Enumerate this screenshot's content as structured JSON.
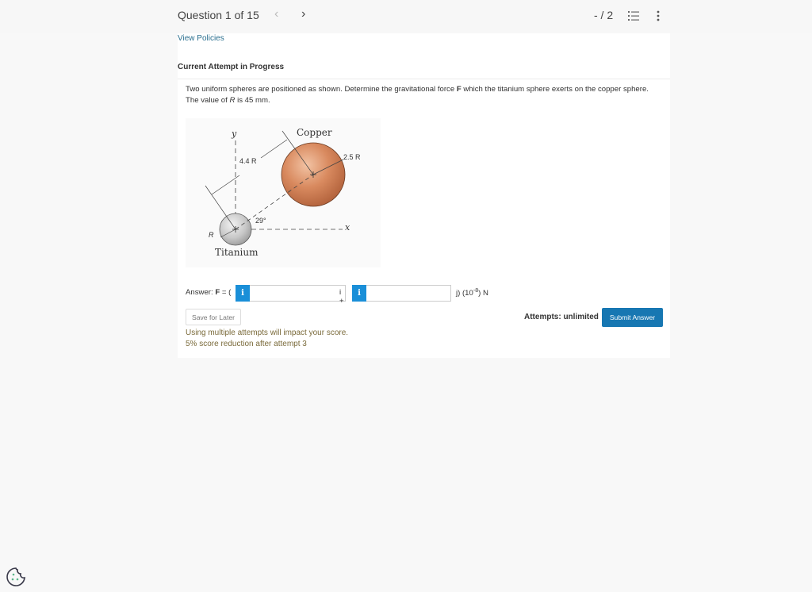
{
  "header": {
    "question_label": "Question 1 of 15",
    "prev_icon": "chevron-left-icon",
    "next_icon": "chevron-right-icon",
    "score": "- / 2",
    "list_icon": "numbered-list-icon",
    "more_icon": "vertical-ellipsis-icon"
  },
  "links": {
    "view_policies": "View Policies"
  },
  "attempt": {
    "heading": "Current Attempt in Progress"
  },
  "question": {
    "text_before_F": "Two uniform spheres are positioned as shown. Determine the gravitational force ",
    "bold_F": "F",
    "text_after_F": " which the titanium sphere exerts on the copper sphere. The value of ",
    "italic_R": "R",
    "text_end": " is 45 mm."
  },
  "figure": {
    "copper_label": "Copper",
    "titanium_label": "Titanium",
    "distance_label": "4.4 R",
    "copper_radius_label": "2.5 R",
    "titanium_radius_label": "R",
    "angle_label": "29°",
    "x_axis": "x",
    "y_axis": "y",
    "copper_color": "#d98a5f",
    "titanium_color": "#c8c8c8"
  },
  "answer": {
    "prefix": "Answer: ",
    "bold_F": "F",
    "open": " = (",
    "info_glyph": "i",
    "i_value": "",
    "mid": "i +",
    "j_value": "",
    "suffix_j": "j) (10",
    "exponent": "-8",
    "suffix_unit": ") N"
  },
  "actions": {
    "save_label": "Save for Later",
    "attempts_label": "Attempts: unlimited",
    "submit_label": "Submit Answer"
  },
  "warnings": {
    "line1": "Using multiple attempts will impact your score.",
    "line2": "5% score reduction after attempt 3"
  },
  "colors": {
    "accent": "#1777b2",
    "info": "#1a8fd8",
    "link": "#2a6f8f",
    "warning_text": "#7a6a3a"
  }
}
